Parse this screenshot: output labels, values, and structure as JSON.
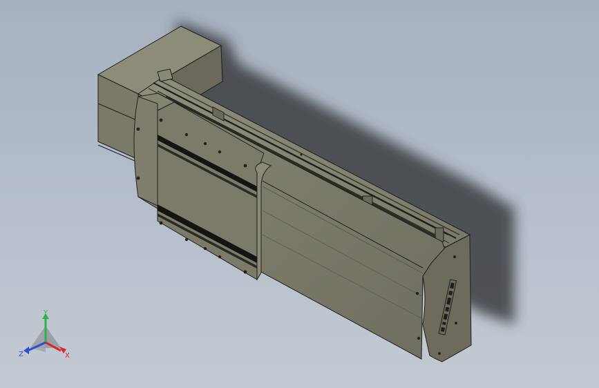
{
  "viewport": {
    "background_top": "#a6b0bf",
    "background_bottom": "#c4cad3"
  },
  "model": {
    "body_color": "#7d7c6b",
    "body_dark": "#55554a",
    "edge_color": "#1e1e1c",
    "shadow_color": "#3a3c40",
    "logo_icon": "brand-logo-icon"
  },
  "triad": {
    "x_label": "X",
    "y_label": "Y",
    "z_label": "Z",
    "x_color": "#d8262a",
    "y_color": "#2bb24a",
    "z_color": "#2a4fd1"
  }
}
